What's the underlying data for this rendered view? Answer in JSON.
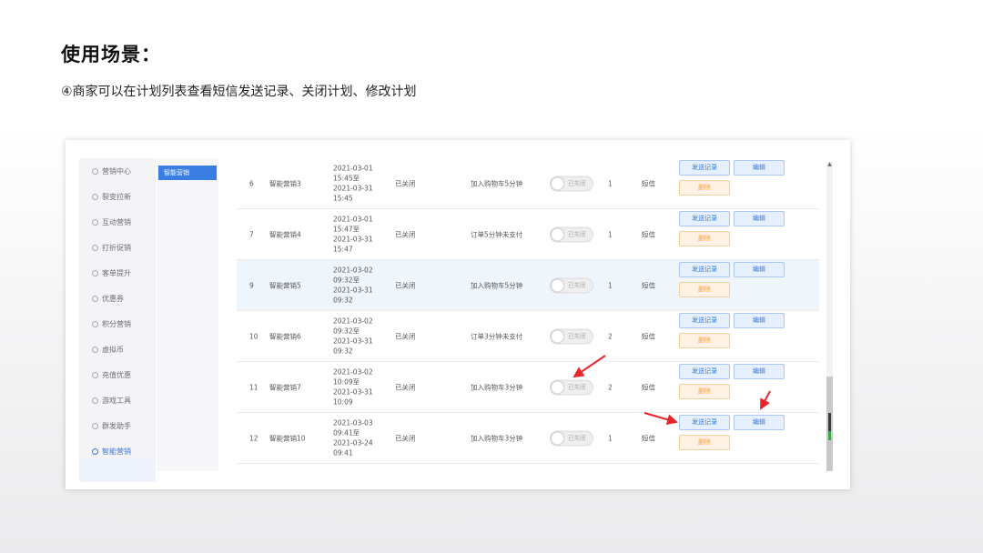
{
  "slide": {
    "title": "使用场景：",
    "subtitle": "④商家可以在计划列表查看短信发送记录、关闭计划、修改计划"
  },
  "sidebar": {
    "items": [
      {
        "label": "营销中心",
        "icon": "marketing-icon"
      },
      {
        "label": "裂变拉新",
        "icon": "fission-icon"
      },
      {
        "label": "互动营销",
        "icon": "interactive-icon"
      },
      {
        "label": "打折促销",
        "icon": "discount-icon"
      },
      {
        "label": "客单提升",
        "icon": "order-value-icon"
      },
      {
        "label": "优惠券",
        "icon": "coupon-icon"
      },
      {
        "label": "积分营销",
        "icon": "points-icon"
      },
      {
        "label": "虚拟币",
        "icon": "virtual-coin-icon"
      },
      {
        "label": "充值优惠",
        "icon": "recharge-icon"
      },
      {
        "label": "游戏工具",
        "icon": "game-icon"
      },
      {
        "label": "群发助手",
        "icon": "broadcast-icon"
      },
      {
        "label": "智能营销",
        "icon": "smart-marketing-icon",
        "active": true
      }
    ]
  },
  "sub_panel": {
    "active_tab": "智能营销"
  },
  "table": {
    "rows": [
      {
        "id": "6",
        "name": "智能营销3",
        "time": [
          "2021-03-01",
          "15:45至",
          "2021-03-31",
          "15:45"
        ],
        "status": "已关闭",
        "trigger": "加入购物车5分钟",
        "toggle_label": "已关闭",
        "count": "1",
        "channel": "短信",
        "highlight": false
      },
      {
        "id": "7",
        "name": "智能营销4",
        "time": [
          "2021-03-01",
          "15:47至",
          "2021-03-31",
          "15:47"
        ],
        "status": "已关闭",
        "trigger": "订单5分钟未支付",
        "toggle_label": "已关闭",
        "count": "1",
        "channel": "短信",
        "highlight": false
      },
      {
        "id": "9",
        "name": "智能营销5",
        "time": [
          "2021-03-02",
          "09:32至",
          "2021-03-31",
          "09:32"
        ],
        "status": "已关闭",
        "trigger": "加入购物车5分钟",
        "toggle_label": "已关闭",
        "count": "1",
        "channel": "短信",
        "highlight": true
      },
      {
        "id": "10",
        "name": "智能营销6",
        "time": [
          "2021-03-02",
          "09:32至",
          "2021-03-31",
          "09:32"
        ],
        "status": "已关闭",
        "trigger": "订单3分钟未支付",
        "toggle_label": "已关闭",
        "count": "2",
        "channel": "短信",
        "highlight": false
      },
      {
        "id": "11",
        "name": "智能营销7",
        "time": [
          "2021-03-02",
          "10:09至",
          "2021-03-31",
          "10:09"
        ],
        "status": "已关闭",
        "trigger": "加入购物车3分钟",
        "toggle_label": "已关闭",
        "count": "2",
        "channel": "短信",
        "highlight": false
      },
      {
        "id": "12",
        "name": "智能营销10",
        "time": [
          "2021-03-03",
          "09:41至",
          "2021-03-24",
          "09:41"
        ],
        "status": "已关闭",
        "trigger": "加入购物车3分钟",
        "toggle_label": "已关闭",
        "count": "1",
        "channel": "短信",
        "highlight": false
      }
    ],
    "buttons": {
      "send_record": "发送记录",
      "edit": "编辑",
      "delete": "删除"
    }
  },
  "colors": {
    "primary": "#3a7ee4",
    "annotation_arrow": "#e8262a",
    "delete": "#f0a04a"
  }
}
